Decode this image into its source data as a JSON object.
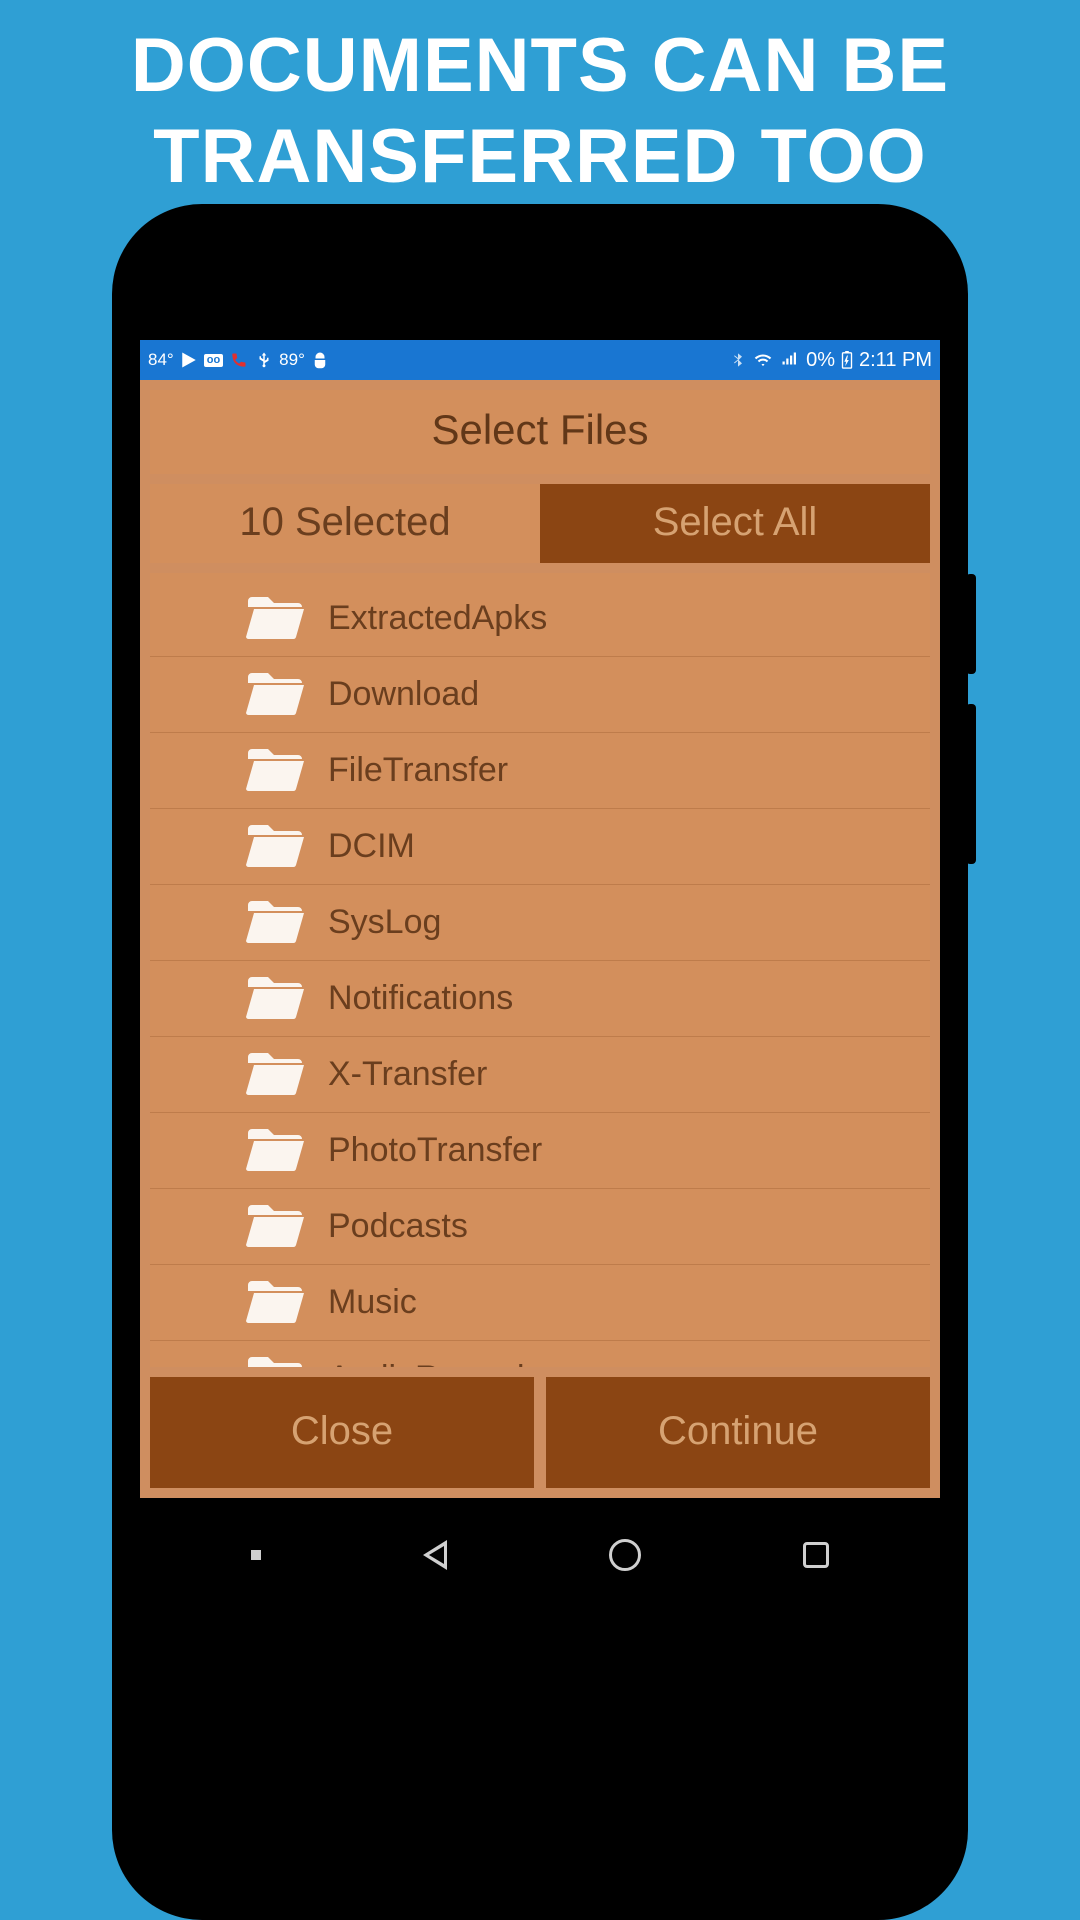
{
  "promo": {
    "line1": "DOCUMENTS CAN BE",
    "line2": "TRANSFERRED TOO"
  },
  "statusbar": {
    "temp1": "84°",
    "temp2": "89°",
    "battery": "0%",
    "time": "2:11 PM"
  },
  "header": {
    "title": "Select Files"
  },
  "selection": {
    "count_label": "10 Selected",
    "select_all_label": "Select All"
  },
  "files": [
    {
      "name": "ExtractedApks"
    },
    {
      "name": "Download"
    },
    {
      "name": "FileTransfer"
    },
    {
      "name": "DCIM"
    },
    {
      "name": "SysLog"
    },
    {
      "name": "Notifications"
    },
    {
      "name": "X-Transfer"
    },
    {
      "name": "PhotoTransfer"
    },
    {
      "name": "Podcasts"
    },
    {
      "name": "Music"
    },
    {
      "name": "AudioRecorder"
    }
  ],
  "buttons": {
    "close": "Close",
    "continue": "Continue"
  }
}
